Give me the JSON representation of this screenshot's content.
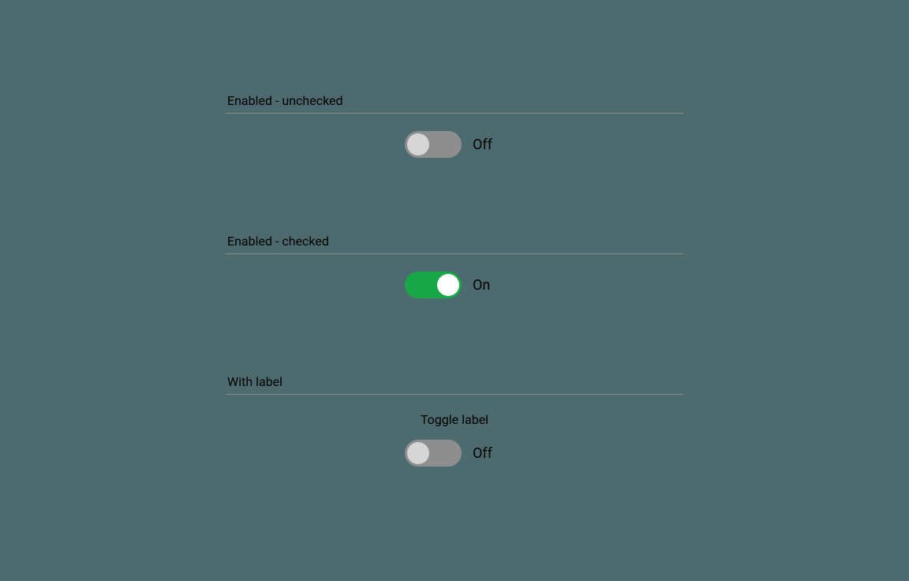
{
  "sections": {
    "unchecked": {
      "heading": "Enabled - unchecked",
      "state_text": "Off",
      "checked": false
    },
    "checked": {
      "heading": "Enabled - checked",
      "state_text": "On",
      "checked": true
    },
    "with_label": {
      "heading": "With label",
      "toggle_label": "Toggle label",
      "state_text": "Off",
      "checked": false
    }
  },
  "colors": {
    "background": "#4d6a6e",
    "switch_off_track": "#8e8e8e",
    "switch_off_knob": "#d6d6d6",
    "switch_on_track": "#18a748",
    "switch_on_knob": "#ffffff"
  }
}
